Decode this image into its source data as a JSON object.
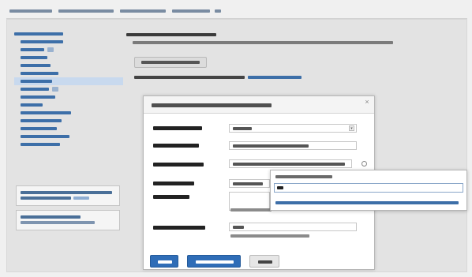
{
  "breadcrumb": {
    "text": ""
  },
  "sidebar": {
    "items": [
      "",
      "",
      "",
      "",
      "",
      "",
      "",
      "",
      "",
      "",
      "",
      "",
      "",
      "",
      ""
    ],
    "box1": "",
    "box2": ""
  },
  "heading": {
    "title": "",
    "description": ""
  },
  "toolbar": {
    "button": ""
  },
  "note": "",
  "dialog": {
    "title": "",
    "close": "×",
    "fields": [
      "",
      "",
      "",
      "",
      "",
      ""
    ]
  },
  "popup": {
    "label": "",
    "input_value": "",
    "suggestion": ""
  },
  "buttons": {
    "primary": "",
    "secondary": "",
    "cancel": ""
  },
  "colors": {
    "accent": "#2f6db7",
    "link": "#3d6fa8",
    "active_item": "#c8d9ee",
    "page_background": "#e3e3e3"
  }
}
